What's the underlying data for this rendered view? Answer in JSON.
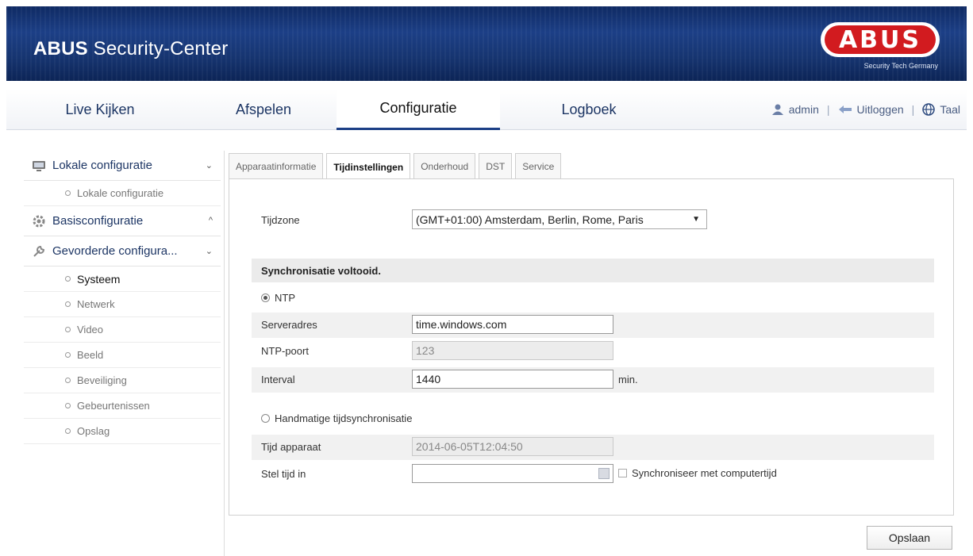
{
  "header": {
    "title_brand": "ABUS",
    "title_rest": " Security-Center",
    "logo_text": "ABUS",
    "logo_tagline": "Security Tech Germany"
  },
  "nav": {
    "tabs": [
      {
        "label": "Live Kijken"
      },
      {
        "label": "Afspelen"
      },
      {
        "label": "Configuratie"
      },
      {
        "label": "Logboek"
      }
    ],
    "user": "admin",
    "logout": "Uitloggen",
    "language": "Taal",
    "separator": "|"
  },
  "sidebar": {
    "groups": [
      {
        "label": "Lokale configuratie",
        "chevron": "⌄"
      },
      {
        "label": "Basisconfiguratie",
        "chevron": "^"
      },
      {
        "label": "Gevorderde configura...",
        "chevron": "⌄"
      }
    ],
    "local_items": [
      {
        "label": "Lokale configuratie"
      }
    ],
    "advanced_items": [
      {
        "label": "Systeem"
      },
      {
        "label": "Netwerk"
      },
      {
        "label": "Video"
      },
      {
        "label": "Beeld"
      },
      {
        "label": "Beveiliging"
      },
      {
        "label": "Gebeurtenissen"
      },
      {
        "label": "Opslag"
      }
    ]
  },
  "tabs": [
    {
      "label": "Apparaatinformatie"
    },
    {
      "label": "Tijdinstellingen"
    },
    {
      "label": "Onderhoud"
    },
    {
      "label": "DST"
    },
    {
      "label": "Service"
    }
  ],
  "form": {
    "timezone_label": "Tijdzone",
    "timezone_value": "(GMT+01:00) Amsterdam, Berlin, Rome, Paris",
    "sync_status": "Synchronisatie voltooid.",
    "ntp_label": "NTP",
    "server_label": "Serveradres",
    "server_value": "time.windows.com",
    "port_label": "NTP-poort",
    "port_value": "123",
    "interval_label": "Interval",
    "interval_value": "1440",
    "interval_unit": "min.",
    "manual_label": "Handmatige tijdsynchronisatie",
    "device_time_label": "Tijd apparaat",
    "device_time_value": "2014-06-05T12:04:50",
    "set_time_label": "Stel tijd in",
    "set_time_value": "",
    "sync_pc_label": "Synchroniseer met computertijd"
  },
  "save_label": "Opslaan",
  "colors": {
    "header_blue": "#1c3f86",
    "logo_red": "#d21b1f",
    "nav_text": "#1c3564"
  }
}
